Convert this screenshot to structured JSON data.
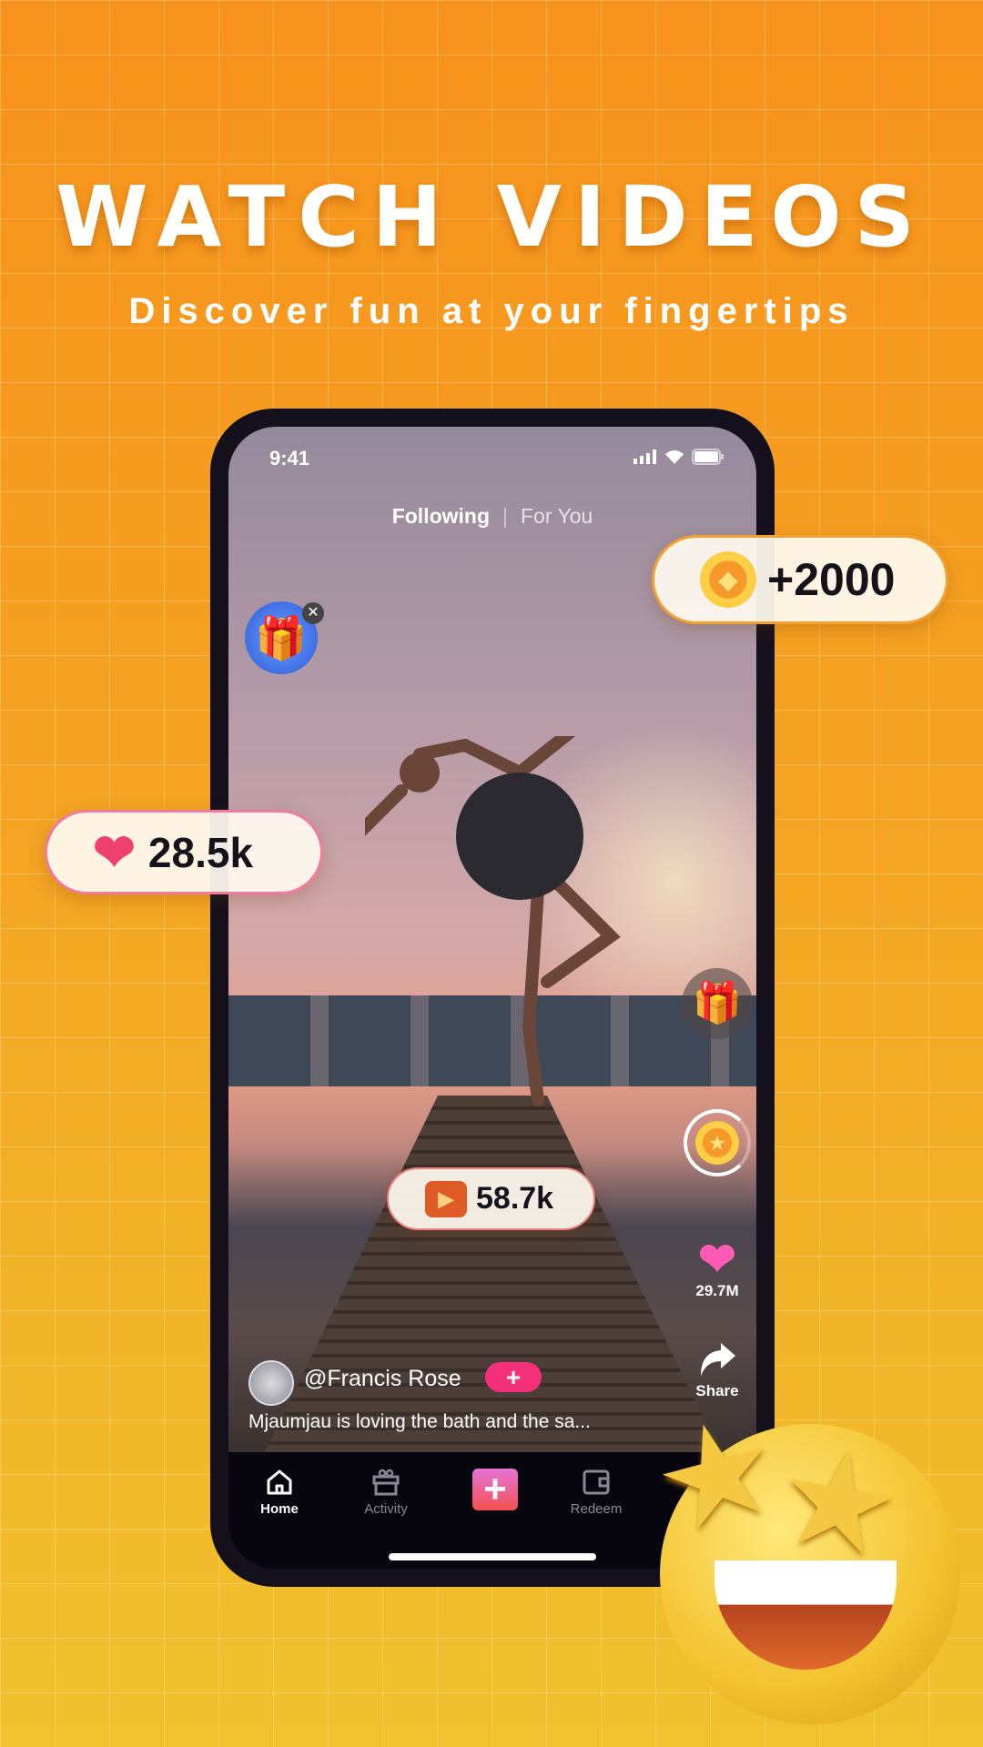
{
  "hero": {
    "title": "WATCH VIDEOS",
    "subtitle": "Discover fun at your fingertips"
  },
  "status_bar": {
    "time": "9:41"
  },
  "feed_tabs": {
    "following": "Following",
    "for_you": "For You",
    "active": "Following"
  },
  "side_actions": {
    "likes": "29.7M",
    "share_label": "Share"
  },
  "post": {
    "username": "@Francis Rose",
    "caption": "Mjaumjau is loving the bath and the sa..."
  },
  "nav": {
    "items": [
      {
        "label": "Home",
        "icon": "home-icon",
        "active": true
      },
      {
        "label": "Activity",
        "icon": "gift-icon"
      },
      {
        "label": "",
        "icon": "plus-icon"
      },
      {
        "label": "Redeem",
        "icon": "wallet-icon"
      }
    ]
  },
  "badges": {
    "coins": "+2000",
    "hearts": "28.5k",
    "views": "58.7k"
  },
  "colors": {
    "accent_pink": "#f5307a",
    "bg_top": "#f7921c",
    "bg_bottom": "#f0c22e"
  }
}
